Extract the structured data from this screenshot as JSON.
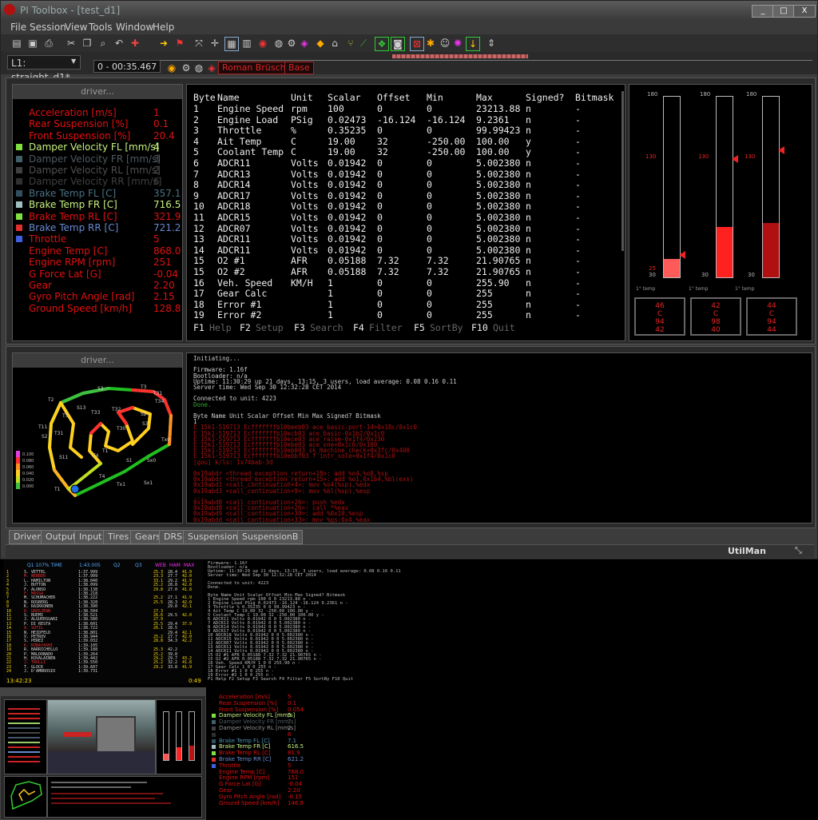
{
  "window": {
    "title": "PI Toolbox - [test_d1]",
    "controls": [
      "_",
      "□",
      "X"
    ]
  },
  "menu": [
    "File",
    "Session",
    "View",
    "Tools",
    "Window",
    "Help"
  ],
  "toolbar2": {
    "session": "L1: straight_d1*",
    "time": "0 - 00:35.467",
    "driver": "Roman Brüscher",
    "setup": "Base"
  },
  "channel_panel": {
    "header": "driver...",
    "items": [
      {
        "name": "Acceleration  [m/s]",
        "value": "1",
        "color": "#e01010",
        "swatch": ""
      },
      {
        "name": "Rear Suspension  [%]",
        "value": "0.1",
        "color": "#e01010",
        "swatch": ""
      },
      {
        "name": "Front Suspension  [%]",
        "value": "20.4",
        "color": "#e01010",
        "swatch": ""
      },
      {
        "name": "Damper Velocity FL  [mm/s]",
        "value": "4",
        "color": "#c8f080",
        "swatch": "#80e040"
      },
      {
        "name": "Damper Velocity FR  [mm/s]",
        "value": "3",
        "color": "#505a60",
        "swatch": "#40606a"
      },
      {
        "name": "Damper Velocity RL  [mm/s]",
        "value": "2",
        "color": "#505050",
        "swatch": "#404040"
      },
      {
        "name": "Damper Velocity RR  [mm/s]",
        "value": "6",
        "color": "#404040",
        "swatch": "#303030"
      },
      {
        "name": "Brake Temp FL  [C]",
        "value": "357.1",
        "color": "#4a7080",
        "swatch": "#305060"
      },
      {
        "name": "Brake Temp FR  [C]",
        "value": "716.5",
        "color": "#c8f080",
        "swatch": "#a0c0c0"
      },
      {
        "name": "Brake Temp RL  [C]",
        "value": "321.9",
        "color": "#e01010",
        "swatch": "#80e040"
      },
      {
        "name": "Brake Temp RR  [C]",
        "value": "721.2",
        "color": "#6a8ad0",
        "swatch": "#e03030"
      },
      {
        "name": "Throttle",
        "value": "5",
        "color": "#e01010",
        "swatch": "#4060e0"
      },
      {
        "name": "Engine Temp  [C]",
        "value": "868.0",
        "color": "#e01010",
        "swatch": ""
      },
      {
        "name": "Engine RPM  [rpm]",
        "value": "251",
        "color": "#e01010",
        "swatch": ""
      },
      {
        "name": "G Force Lat  [G]",
        "value": "-0.04",
        "color": "#e01010",
        "swatch": ""
      },
      {
        "name": "Gear",
        "value": "2.20",
        "color": "#e01010",
        "swatch": ""
      },
      {
        "name": "Gyro Pitch Angle  [rad]",
        "value": "2.15",
        "color": "#e01010",
        "swatch": ""
      },
      {
        "name": "Ground Speed  [km/h]",
        "value": "128.8",
        "color": "#e01010",
        "swatch": ""
      }
    ]
  },
  "table": {
    "columns": [
      "Byte",
      "Name",
      "Unit",
      "Scalar",
      "Offset",
      "Min",
      "Max",
      "Signed?",
      "Bitmask"
    ],
    "rows": [
      [
        "1",
        "Engine Speed",
        "rpm",
        "100",
        "0",
        "0",
        "23213.88",
        "n",
        "-"
      ],
      [
        "2",
        "Engine Load",
        "PSig",
        "0.02473",
        "-16.124",
        "-16.124",
        "9.2361",
        "n",
        "-"
      ],
      [
        "3",
        "Throttle",
        "%",
        "0.35235",
        "0",
        "0",
        "99.99423",
        "n",
        "-"
      ],
      [
        "4",
        "Ait Temp",
        "C",
        "19.00",
        "32",
        "-250.00",
        "100.00",
        "y",
        "-"
      ],
      [
        "5",
        "Coolant Temp",
        "C",
        "19.00",
        "32",
        "-250.00",
        "100.00",
        "y",
        "-"
      ],
      [
        "6",
        "ADCR11",
        "Volts",
        "0.01942",
        "0",
        "0",
        "5.002380",
        "n",
        "-"
      ],
      [
        "7",
        "ADCR13",
        "Volts",
        "0.01942",
        "0",
        "0",
        "5.002380",
        "n",
        "-"
      ],
      [
        "8",
        "ADCR14",
        "Volts",
        "0.01942",
        "0",
        "0",
        "5.002380",
        "n",
        "-"
      ],
      [
        "9",
        "ADCR17",
        "Volts",
        "0.01942",
        "0",
        "0",
        "5.002380",
        "n",
        "-"
      ],
      [
        "10",
        "ADCR18",
        "Volts",
        "0.01942",
        "0",
        "0",
        "5.002380",
        "n",
        "-"
      ],
      [
        "11",
        "ADCR15",
        "Volts",
        "0.01942",
        "0",
        "0",
        "5.002380",
        "n",
        "-"
      ],
      [
        "12",
        "ADCR07",
        "Volts",
        "0.01942",
        "0",
        "0",
        "5.002380",
        "n",
        "-"
      ],
      [
        "13",
        "ADCR11",
        "Volts",
        "0.01942",
        "0",
        "0",
        "5.002380",
        "n",
        "-"
      ],
      [
        "14",
        "ADCR11",
        "Volts",
        "0.01942",
        "0",
        "0",
        "5.002380",
        "n",
        "-"
      ],
      [
        "15",
        "O2 #1",
        "AFR",
        "0.05188",
        "7.32",
        "7.32",
        "21.90765",
        "n",
        "-"
      ],
      [
        "15",
        "O2 #2",
        "AFR",
        "0.05188",
        "7.32",
        "7.32",
        "21.90765",
        "n",
        "-"
      ],
      [
        "16",
        "Veh. Speed",
        "KM/H",
        "1",
        "0",
        "0",
        "255.90",
        "n",
        "-"
      ],
      [
        "17",
        "Gear Calc",
        "",
        "1",
        "0",
        "0",
        "255",
        "n",
        "-"
      ],
      [
        "18",
        "Error #1",
        "",
        "1",
        "0",
        "0",
        "255",
        "n",
        "-"
      ],
      [
        "19",
        "Error #2",
        "",
        "1",
        "0",
        "0",
        "255",
        "n",
        "-"
      ]
    ],
    "fkeys": [
      {
        "key": "F1",
        "label": "Help"
      },
      {
        "key": "F2",
        "label": "Setup"
      },
      {
        "key": "F3",
        "label": "Search"
      },
      {
        "key": "F4",
        "label": "Filter"
      },
      {
        "key": "F5",
        "label": "SortBy"
      },
      {
        "key": "F10",
        "label": "Quit"
      }
    ]
  },
  "gauges": {
    "labels": {
      "top": "180",
      "bottom": "30",
      "mid": "130",
      "low": "25"
    },
    "items": [
      {
        "level": 0.1,
        "marker": 0.12,
        "color": "#ff5a5a",
        "name": "1° temp",
        "box": [
          "46",
          "C",
          "94",
          "42"
        ]
      },
      {
        "level": 0.28,
        "marker": 0.65,
        "color": "#ff2020",
        "name": "1° temp",
        "box": [
          "42",
          "C",
          "98",
          "40"
        ]
      },
      {
        "level": 0.3,
        "marker": 0.7,
        "color": "#b01010",
        "name": "1° temp",
        "box": [
          "44",
          "C",
          "94",
          "44"
        ]
      }
    ]
  },
  "map_panel": {
    "header": "driver...",
    "legend": [
      "0.100",
      "0.080",
      "0.060",
      "0.040",
      "0.020",
      "0.000"
    ],
    "labels": [
      "S3",
      "T2",
      "T3",
      "T31",
      "T5",
      "S13",
      "T33",
      "T32",
      "S2",
      "T11",
      "T31",
      "S11",
      "T1",
      "T4",
      "S1",
      "T30",
      "S3",
      "Tx0",
      "Sx0",
      "Tx1",
      "Sx1",
      "T4",
      "T34",
      "S2",
      "T1"
    ]
  },
  "terminal": {
    "lines": [
      {
        "t": "Initiating...",
        "c": "#ccc"
      },
      {
        "t": "",
        "c": "#ccc"
      },
      {
        "t": "Firmware: 1.16f",
        "c": "#ccc"
      },
      {
        "t": "Bootloader: n/a",
        "c": "#ccc"
      },
      {
        "t": "Uptime:  11:30:29 up 21 days, 13:15,  3 users,  load average: 0.08  0.16  0.11",
        "c": "#ccc"
      },
      {
        "t": "Server time: Wed Sep 30 12:32:28 CET 2014",
        "c": "#ccc"
      },
      {
        "t": "",
        "c": "#ccc"
      },
      {
        "t": "Connected to unit: 4223",
        "c": "#ccc"
      },
      {
        "t": "Done.",
        "c": "#3a3"
      },
      {
        "t": "",
        "c": "#ccc"
      },
      {
        "t": "Byte  Name                         Unit        Scalar        Offset        Min              Max              Signed?       Bitmask",
        "c": "#ccc"
      },
      {
        "t": "1",
        "c": "#ccc"
      },
      {
        "t": "E 15k1-519713  Ecfffffffb10beeb03 ace_basic-port-14>0x18c/0x1c0",
        "c": "#a11"
      },
      {
        "t": "E 15k1-519713  Ecfffffffb10ecb03 ace_basic-0x1b2/0x1c0",
        "c": "#a11"
      },
      {
        "t": "E 15k1-519713  Ecfffffffb10ece03 ace_raise-0x1f4/0x230",
        "c": "#a11"
      },
      {
        "t": "E 15k1-519713  Ecfffffffb10ebe03 ace_one+0x1c0/0x100",
        "c": "#a11"
      },
      {
        "t": "E 15k1-519713  Ecfffffffb10eb003 sk_machine_check+0x3fc/0x400",
        "c": "#a11"
      },
      {
        "t": "E 15k1-519713  Ecfffffffb10ebbf03 f intr_sole+0x1f4/0x1c0",
        "c": "#a11"
      },
      {
        "t": "[gou] k/ls: 1x74bab-3d",
        "c": "#a11"
      },
      {
        "t": "",
        "c": "#a11"
      },
      {
        "t": "0x19abdr <thread_exception_return+18>: add     %o4,%o0,%sp",
        "c": "#a11"
      },
      {
        "t": "0x19abdr <thread_exception_return+15>: add     %o1,0x1b4,%bl(exs)",
        "c": "#a11"
      },
      {
        "t": "0x19abd1 <call_continuation+4>: mov     %o4(%sp),%edx",
        "c": "#a11"
      },
      {
        "t": "0x19abd3 <call_continuation+9>: mov     %bl(%sp),%esp",
        "c": "#a11"
      },
      {
        "t": "...",
        "c": "#a11"
      },
      {
        "t": "0x19abd8 <call_continuation+26>: push    %edx",
        "c": "#a11"
      },
      {
        "t": "0x19abd8 <call_continuation+26>: call    *%eax",
        "c": "#a11"
      },
      {
        "t": "0x19abd9 <call_continuation+30>: add     %0x10,%esp",
        "c": "#a11"
      },
      {
        "t": "0x19abdd <call_continuation+33>: mov     %gs:0x4,%eax",
        "c": "#a11"
      }
    ]
  },
  "tabs": [
    "Driver",
    "Output",
    "Input",
    "Tires",
    "Gears",
    "DRS",
    "SuspensionA",
    "SuspensionB"
  ],
  "statusbar": {
    "text": "UtilMan"
  },
  "timing": {
    "headers": [
      "Q1 107% TIME",
      "1:43.005",
      "Q2",
      "Q3",
      "WEB",
      "HAM",
      "MAX"
    ],
    "rows": [
      [
        "1",
        "S. VETTEL",
        "1:37.999",
        "",
        "",
        "25.3",
        "28.4",
        "41.9"
      ],
      [
        "2",
        "M. WEBBER",
        "1:37.999",
        "",
        "",
        "23.3",
        "27.7",
        "42.0"
      ],
      [
        "3",
        "L. HAMILTON",
        "1:38.040",
        "",
        "",
        "33.1",
        "29.2",
        "41.9"
      ],
      [
        "4",
        "J. BUTTON",
        "1:38.099",
        "",
        "",
        "25.2",
        "28.8",
        "42.0"
      ],
      [
        "5",
        "F. ALONSO",
        "1:38.138",
        "",
        "",
        "29.8",
        "27.0",
        "41.8"
      ],
      [
        "6",
        "F. MASSA",
        "1:38.218",
        "",
        "",
        "",
        "",
        ""
      ],
      [
        "7",
        "M. SCHUMACHER",
        "1:38.222",
        "",
        "",
        "25.2",
        "27.1",
        "41.9"
      ],
      [
        "8",
        "N. ROSBERG",
        "1:38.328",
        "",
        "",
        "25.5",
        "28.3",
        "42.0"
      ],
      [
        "9",
        "K. RAIKKONEN",
        "1:38.390",
        "",
        "",
        "",
        "29.0",
        "42.1"
      ],
      [
        "10",
        "R. GROSJEAN",
        "1:38.504",
        "",
        "",
        "27.3",
        "",
        ""
      ],
      [
        "11",
        "S. BUEMI",
        "1:38.521",
        "",
        "",
        "26.6",
        "29.5",
        "42.0"
      ],
      [
        "12",
        "J. ALGUERSUARI",
        "1:38.580",
        "",
        "",
        "27.9",
        "",
        ""
      ],
      [
        "13",
        "P. DI RESTA",
        "1:38.601",
        "",
        "",
        "25.5",
        "29.4",
        "37.9"
      ],
      [
        "14",
        "A. SUTIL",
        "1:38.722",
        "",
        "",
        "26.1",
        "28.5",
        ""
      ],
      [
        "15",
        "N. HEIDFELD",
        "1:38.801",
        "",
        "",
        "",
        "29.4",
        "42.1"
      ],
      [
        "16",
        "V. PETROV",
        "1:38.944",
        "",
        "",
        "25.2",
        "27.7",
        "42.0"
      ],
      [
        "17",
        "S. PEREZ",
        "1:39.032",
        "",
        "",
        "28.8",
        "34.3",
        "42.2"
      ],
      [
        "18",
        "K. KOBAYASHI",
        "1:39.105",
        "",
        "",
        "",
        "",
        ""
      ],
      [
        "19",
        "R. BARRICHELLO",
        "1:39.188",
        "",
        "",
        "25.3",
        "42.2",
        ""
      ],
      [
        "20",
        "P. MALDONADO",
        "1:39.264",
        "",
        "",
        "25.2",
        "39.8",
        ""
      ],
      [
        "21",
        "H. KOVALAINEN",
        "1:39.442",
        "",
        "",
        "29.2",
        "29.7",
        "43.2"
      ],
      [
        "22",
        "J. TRULLI",
        "1:39.550",
        "",
        "",
        "25.2",
        "32.2",
        "41.8"
      ],
      [
        "23",
        "T. GLOCK",
        "1:39.607",
        "",
        "",
        "29.2",
        "33.8",
        "41.9"
      ],
      [
        "24",
        "J. D'AMBROSIO",
        "1:39.731",
        "",
        "",
        "",
        "",
        ""
      ]
    ],
    "clock": "13:42:23",
    "lap": "0:49"
  },
  "mini_terminal": [
    "Firmware: 1.16f",
    "Bootloader: n/a",
    "Uptime:  11:30:29 up 21 days, 13:15,  3 users,  load average: 0.08  0.16  0.11",
    "Server time: Wed Sep 30 12:32:28 CET 2014",
    "",
    "Connected to unit: 4223",
    "Done.",
    "",
    "Byte Name        Unit  Scalar   Offset  Min     Max       Signed?  Bitmask",
    "1    Engine Speed rpm   100      0       0       23213.88  n        -",
    "2    Engine Load  PSig  0.02473  -16.124 -16.124 9.2361    n        -",
    "3    Throttle     %     0.35235  0       0       99.99423  n        -",
    "4    Ait Temp     C     19.00    32      -250.00 100.00    y        -",
    "5    Coolant Temp C     19.00    32      -250.00 100.00    y        -",
    "6    ADCR11       Volts 0.01942  0       0       5.002380  n        -",
    "7    ADCR13       Volts 0.01942  0       0       5.002380  n        -",
    "8    ADCR14       Volts 0.01942  0       0       5.002380  n        -",
    "9    ADCR17       Volts 0.01942  0       0       5.002380  n        -",
    "10   ADCR18       Volts 0.01942  0       0       5.002380  n        -",
    "11   ADCR15       Volts 0.01942  0       0       5.002380  n        -",
    "12   ADCR07       Volts 0.01942  0       0       5.002380  n        -",
    "13   ADCR11       Volts 0.01942  0       0       5.002380  n        -",
    "14   ADCR11       Volts 0.01942  0       0       5.002380  n        -",
    "15   O2 #1        AFR   0.05188  7.32    7.32    21.90765  n        -",
    "15   O2 #2        AFR   0.05188  7.32    7.32    21.90765  n        -",
    "16   Veh. Speed   KM/H  1        0       0       255.90    n        -",
    "17   Gear Calc          1        0       0       255       n        -",
    "18   Error #1           1        0       0       255       n        -",
    "19   Error #2           1        0       0       255       n        -",
    "F1 Help  F2 Setup  F3 Search  F4 Filter  F5 SortBy  F10 Quit"
  ],
  "channel_panel2": {
    "items": [
      {
        "name": "Acceleration  [m/s]",
        "value": "5",
        "color": "#e01010",
        "swatch": ""
      },
      {
        "name": "Rear Suspension  [%]",
        "value": "0.1",
        "color": "#e01010",
        "swatch": ""
      },
      {
        "name": "Front Suspension  [%]",
        "value": "0.054",
        "color": "#e01010",
        "swatch": ""
      },
      {
        "name": "Damper Velocity FL  [mm/s]",
        "value": "5",
        "color": "#c8f080",
        "swatch": "#80e040"
      },
      {
        "name": "Damper Velocity FR  [mm/s]",
        "value": "7",
        "color": "#505a60",
        "swatch": "#40606a"
      },
      {
        "name": "Damper Velocity RL  [mm/s]",
        "value": "2",
        "color": "#909090",
        "swatch": "#404040"
      },
      {
        "name": "",
        "value": "6",
        "color": "#e01010",
        "swatch": "#303030"
      },
      {
        "name": "Brake Temp FL  [C]",
        "value": "7.1",
        "color": "#4a90b0",
        "swatch": "#305060"
      },
      {
        "name": "Brake Temp FR  [C]",
        "value": "616.5",
        "color": "#c8f080",
        "swatch": "#a0c0c0"
      },
      {
        "name": "Brake Temp RL  [C]",
        "value": "81.9",
        "color": "#e01010",
        "swatch": "#80e040"
      },
      {
        "name": "Brake Temp RR  [C]",
        "value": "621.2",
        "color": "#6a8ad0",
        "swatch": "#e03030"
      },
      {
        "name": "Throttle",
        "value": "5",
        "color": "#e01010",
        "swatch": "#4060e0"
      },
      {
        "name": "Engine Temp  [C]",
        "value": "768.0",
        "color": "#e01010",
        "swatch": ""
      },
      {
        "name": "Engine RPM  [rpm]",
        "value": "151",
        "color": "#e01010",
        "swatch": ""
      },
      {
        "name": "G Force Lat  [G]",
        "value": "-0.04",
        "color": "#e01010",
        "swatch": ""
      },
      {
        "name": "Gear",
        "value": "2.20",
        "color": "#e01010",
        "swatch": ""
      },
      {
        "name": "Gyro Pitch Angle  [rad]",
        "value": "-0.15",
        "color": "#e01010",
        "swatch": ""
      },
      {
        "name": "Ground Speed  [km/h]",
        "value": "146.8",
        "color": "#e01010",
        "swatch": ""
      }
    ]
  }
}
